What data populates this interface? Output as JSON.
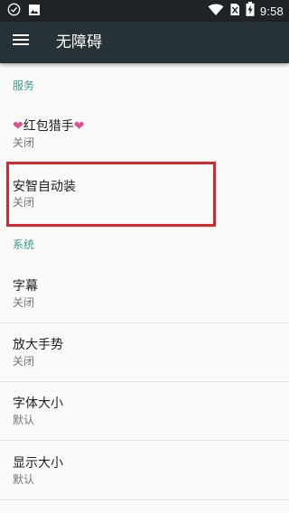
{
  "status_bar": {
    "time": "9:58",
    "left_icons": [
      "check-circle-icon",
      "image-icon"
    ],
    "right_icons": [
      "wifi-icon",
      "no-sim-icon",
      "battery-charging-icon"
    ]
  },
  "toolbar": {
    "title": "无障碍",
    "menu_icon": "menu-icon"
  },
  "sections": {
    "services": {
      "header": "服务",
      "items": [
        {
          "heart_left": "❤",
          "title": "红包猎手",
          "heart_right": "❤",
          "subtitle": "关闭"
        },
        {
          "title": "安智自动装",
          "subtitle": "关闭"
        }
      ]
    },
    "system": {
      "header": "系统",
      "items": [
        {
          "title": "字幕",
          "subtitle": "关闭"
        },
        {
          "title": "放大手势",
          "subtitle": "关闭"
        },
        {
          "title": "字体大小",
          "subtitle": "默认"
        },
        {
          "title": "显示大小",
          "subtitle": "默认"
        }
      ]
    }
  },
  "colors": {
    "status_bar_bg": "#1f2326",
    "toolbar_bg": "#263238",
    "section_header": "#3a9a8e",
    "highlight": "#d9262b",
    "heart": "#e0508f"
  }
}
